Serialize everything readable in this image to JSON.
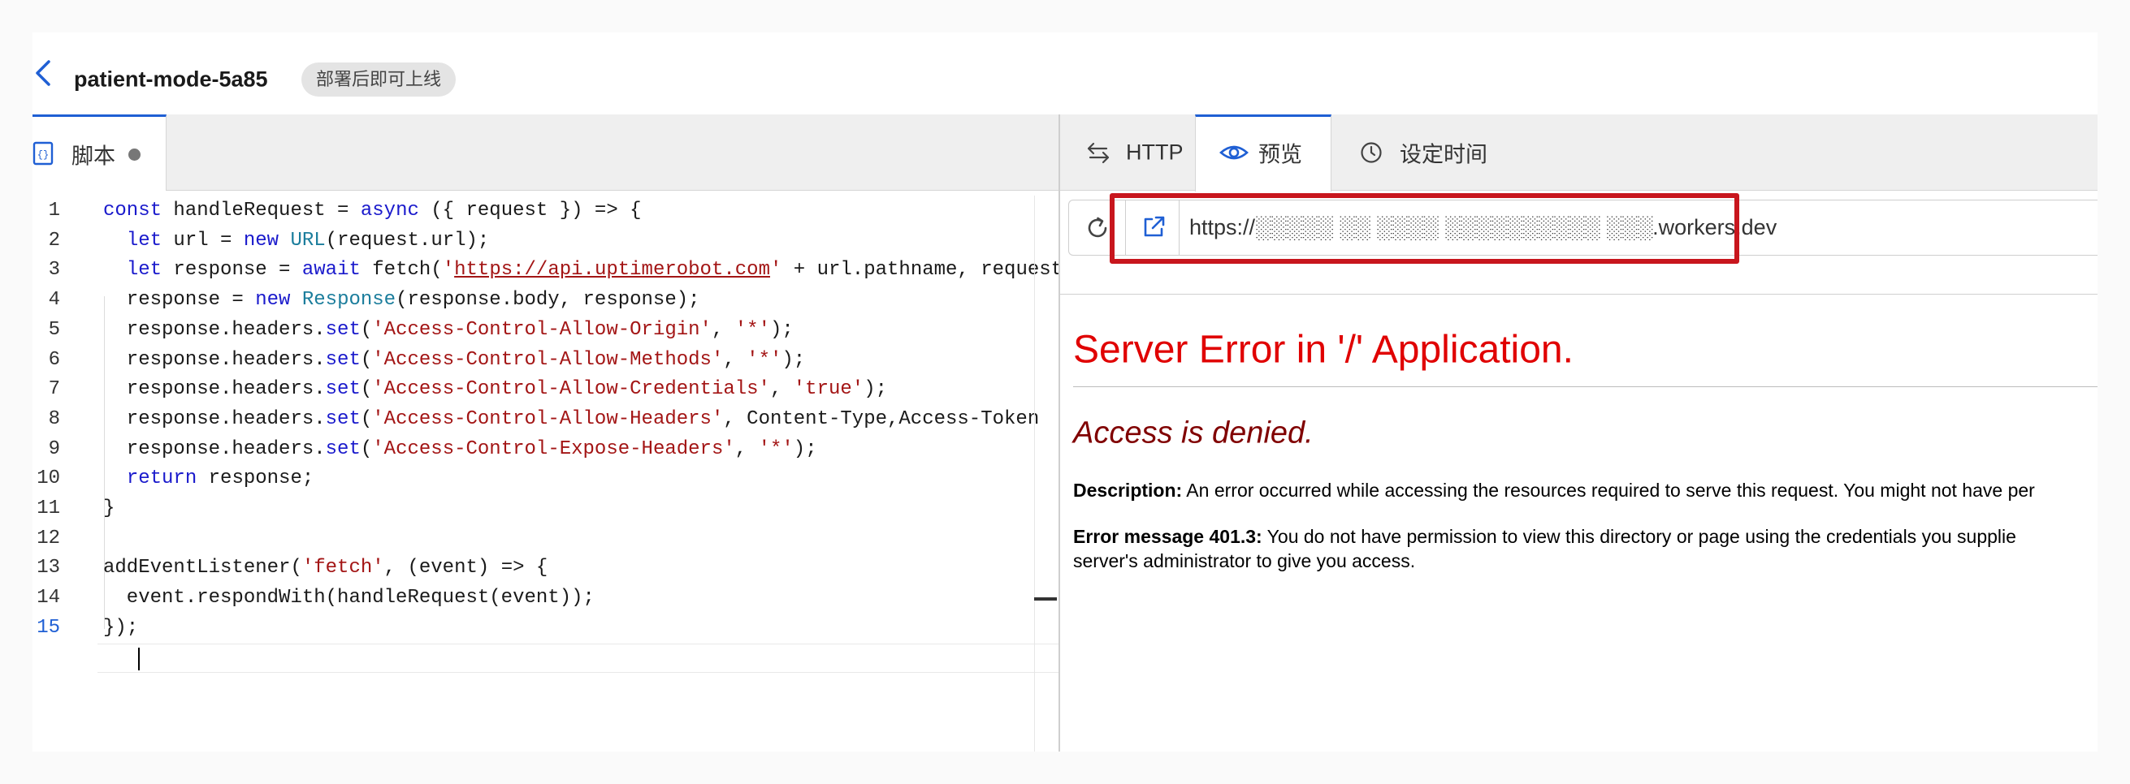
{
  "header": {
    "title": "patient-mode-5a85",
    "status_badge": "部署后即可上线"
  },
  "editor": {
    "tab_label": "脚本",
    "lines": [
      {
        "num": "1",
        "code": "const handleRequest = async ({ request }) => {"
      },
      {
        "num": "2",
        "code": "  let url = new URL(request.url);"
      },
      {
        "num": "3",
        "code": "  let response = await fetch('https://api.uptimerobot.com' + url.pathname, request"
      },
      {
        "num": "4",
        "code": "  response = new Response(response.body, response);"
      },
      {
        "num": "5",
        "code": "  response.headers.set('Access-Control-Allow-Origin', '*');"
      },
      {
        "num": "6",
        "code": "  response.headers.set('Access-Control-Allow-Methods', '*');"
      },
      {
        "num": "7",
        "code": "  response.headers.set('Access-Control-Allow-Credentials', 'true');"
      },
      {
        "num": "8",
        "code": "  response.headers.set('Access-Control-Allow-Headers', 'Content-Type,Access-Token"
      },
      {
        "num": "9",
        "code": "  response.headers.set('Access-Control-Expose-Headers', '*');"
      },
      {
        "num": "10",
        "code": "  return response;"
      },
      {
        "num": "11",
        "code": "}"
      },
      {
        "num": "12",
        "code": ""
      },
      {
        "num": "13",
        "code": "addEventListener('fetch', (event) => {"
      },
      {
        "num": "14",
        "code": "  event.respondWith(handleRequest(event));"
      },
      {
        "num": "15",
        "code": "});"
      }
    ]
  },
  "preview": {
    "tabs": {
      "http": "HTTP",
      "preview": "预览",
      "schedule": "设定时间"
    },
    "url": "https://░░░░░ ░░ ░░░░ ░░░░░░░░░░ ░░░.workers.dev",
    "page": {
      "title": "Server Error in '/' Application.",
      "subtitle": "Access is denied.",
      "description_label": "Description:",
      "description_text": " An error occurred while accessing the resources required to serve this request. You might not have per",
      "error_label": "Error message 401.3:",
      "error_text_1": " You do not have permission to view this directory or page using the credentials you supplie",
      "error_text_2": "server's administrator to give you access."
    }
  },
  "colors": {
    "accent": "#1f5fd4",
    "error_red": "#e00000",
    "error_maroon": "#800000",
    "annotation_red": "#c8161d"
  }
}
